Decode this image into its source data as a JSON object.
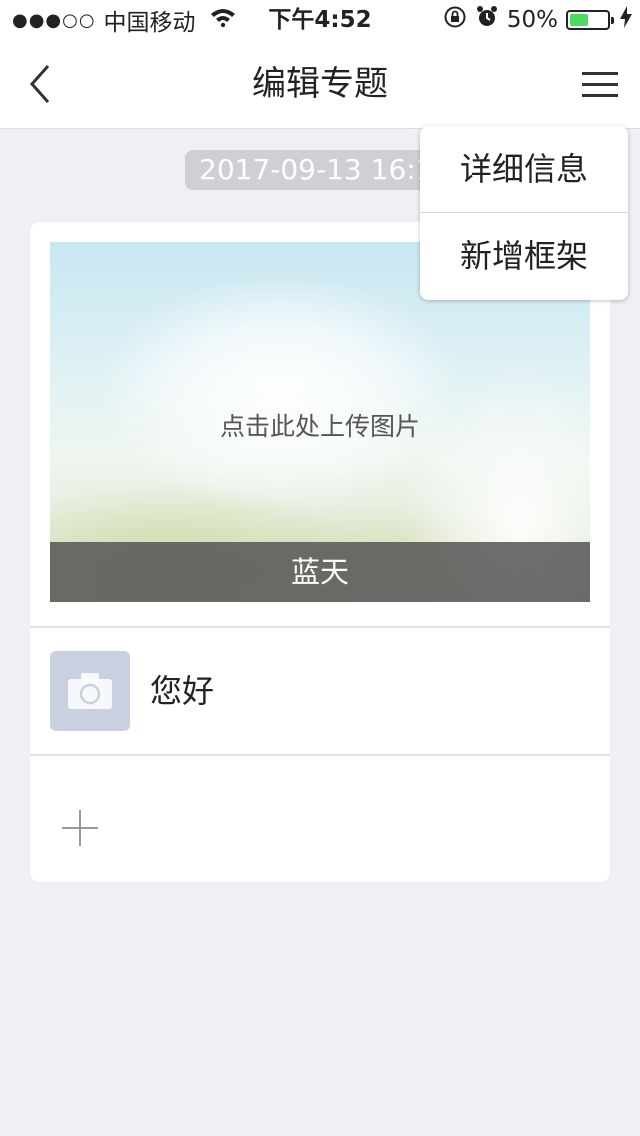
{
  "status_bar": {
    "signal": "●●●○○",
    "carrier": "中国移动",
    "time": "下午4:52",
    "battery_text": "50%",
    "battery_level": 0.5,
    "icons": [
      "wifi-icon",
      "rotation-lock-icon",
      "alarm-icon",
      "battery-icon",
      "charging-icon"
    ]
  },
  "nav": {
    "title": "编辑专题",
    "back_icon": "chevron-left-icon",
    "menu_icon": "hamburger-menu-icon"
  },
  "date_chip": "2017-09-13 16:1",
  "card": {
    "cover_hint": "点击此处上传图片",
    "cover_caption": "蓝天",
    "items": [
      {
        "label": "您好",
        "thumb_icon": "camera-icon"
      }
    ],
    "add_icon": "plus-icon"
  },
  "dropdown": {
    "items": [
      "详细信息",
      "新增框架"
    ]
  },
  "colors": {
    "background": "#efeff4",
    "battery_fill": "#4cd964",
    "thumb_bg": "#c9d1e0",
    "caption_bg": "#555555"
  }
}
